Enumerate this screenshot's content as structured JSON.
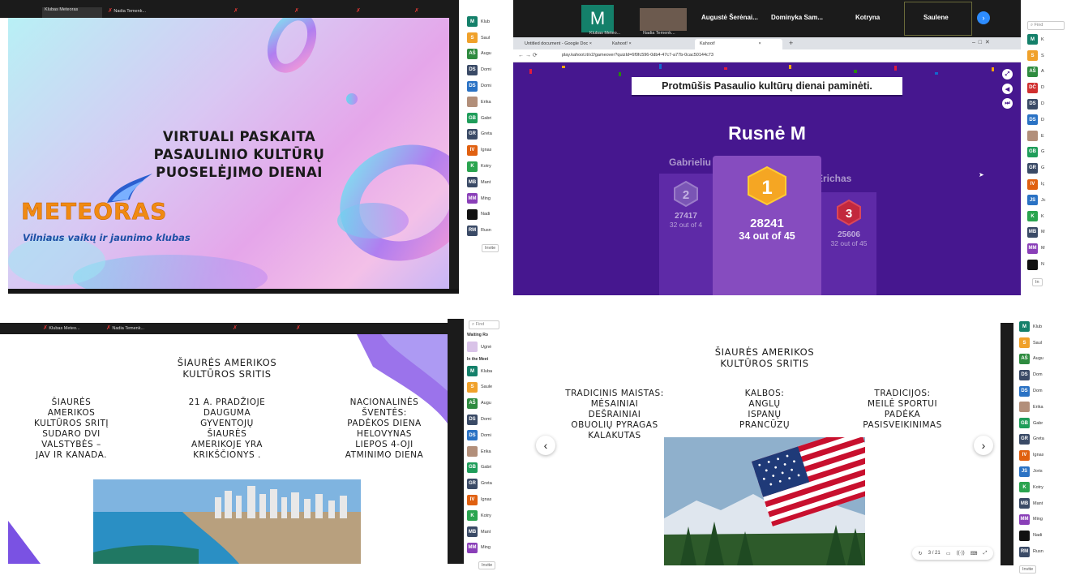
{
  "q1": {
    "strip": [
      {
        "label": "Klubas Meteoras"
      },
      {
        "label": "Nadia Temenk..."
      }
    ],
    "title_lines": [
      "VIRTUALI PASKAITA",
      "PASAULINIO KULTŪRŲ",
      "PUOSELĖJIMO DIENAI"
    ],
    "logo_text": "METEORAS",
    "logo_sub": "Vilniaus vaikų ir jaunimo klubas",
    "participants": [
      {
        "initials": "M",
        "name": "Klub",
        "color": "#14806a"
      },
      {
        "initials": "S",
        "name": "Saul",
        "color": "#f0a12a"
      },
      {
        "initials": "AŠ",
        "name": "Augu",
        "color": "#2e8b3f"
      },
      {
        "initials": "DS",
        "name": "Domi",
        "color": "#3a4a66"
      },
      {
        "initials": "DS",
        "name": "Domi",
        "color": "#2a72c4"
      },
      {
        "initials": "",
        "name": "Erika",
        "color": "#b28f7a"
      },
      {
        "initials": "GB",
        "name": "Gabri",
        "color": "#1f9d5a"
      },
      {
        "initials": "GR",
        "name": "Greta",
        "color": "#3a4a66"
      },
      {
        "initials": "IV",
        "name": "Ignas",
        "color": "#e06010"
      },
      {
        "initials": "K",
        "name": "Kotry",
        "color": "#2aa44f"
      },
      {
        "initials": "MB",
        "name": "Mant",
        "color": "#3a4a66"
      },
      {
        "initials": "MM",
        "name": "Ming",
        "color": "#8a3fb8"
      },
      {
        "initials": "",
        "name": "Nadi",
        "color": "#111111"
      },
      {
        "initials": "RM",
        "name": "Rusn",
        "color": "#3a4a66"
      }
    ],
    "invite": "Invite"
  },
  "q2": {
    "top_tile_letter": "M",
    "top_tile_name": "Klubas Meteo...",
    "top_video_name": "Nadia Temenk...",
    "top_names": [
      "Augustė Šerėnai...",
      "Dominyka Sam...",
      "Kotryna",
      "Saulene"
    ],
    "tabs": [
      "Untitled document - Google Doc",
      "Kahoot!",
      "Kahoot!"
    ],
    "url": "play.kahoot.it/v2/gameover?quizId=6f0fc596-0db4-47c7-a77b-0cac50144c73",
    "quiz_title": "Protmūšis Pasaulio kultūrų dienai paminėti.",
    "winner": "Rusnė M",
    "podium": [
      {
        "rank": "1",
        "name": "",
        "score": "28241",
        "detail": "34 out of 45"
      },
      {
        "rank": "2",
        "name": "Gabrieliu",
        "score": "27417",
        "detail": "32 out of 4"
      },
      {
        "rank": "3",
        "name": "Erichas",
        "score": "25606",
        "detail": "32 out of 45"
      }
    ],
    "participants": [
      {
        "initials": "M",
        "name": "K",
        "color": "#14806a"
      },
      {
        "initials": "S",
        "name": "S",
        "color": "#f0a12a"
      },
      {
        "initials": "AŠ",
        "name": "A",
        "color": "#2e8b3f"
      },
      {
        "initials": "DČ",
        "name": "D",
        "color": "#d03030"
      },
      {
        "initials": "DS",
        "name": "D",
        "color": "#3a4a66"
      },
      {
        "initials": "DS",
        "name": "D",
        "color": "#2a72c4"
      },
      {
        "initials": "",
        "name": "E",
        "color": "#b28f7a"
      },
      {
        "initials": "GB",
        "name": "G",
        "color": "#1f9d5a"
      },
      {
        "initials": "GR",
        "name": "G",
        "color": "#3a4a66"
      },
      {
        "initials": "IV",
        "name": "Iç",
        "color": "#e06010"
      },
      {
        "initials": "JS",
        "name": "Jc",
        "color": "#2a72c4"
      },
      {
        "initials": "K",
        "name": "K",
        "color": "#2aa44f"
      },
      {
        "initials": "MB",
        "name": "M",
        "color": "#3a4a66"
      },
      {
        "initials": "MM",
        "name": "M",
        "color": "#8a3fb8"
      },
      {
        "initials": "",
        "name": "N",
        "color": "#111111"
      }
    ],
    "invite": "In",
    "search_placeholder": "Find"
  },
  "q3": {
    "strip": [
      {
        "label": "Klubas Meteo..."
      },
      {
        "label": "Nadia Temenk..."
      }
    ],
    "heading_lines": [
      "ŠIAURĖS AMERIKOS",
      "KULTŪROS SRITIS"
    ],
    "col1": [
      "ŠIAURĖS",
      "AMERIKOS",
      "KULTŪROS SRITĮ",
      "SUDARO DVI",
      "VALSTYBĖS –",
      "JAV IR KANADA."
    ],
    "col2": [
      "21 A. PRADŽIOJE",
      "DAUGUMA",
      "GYVENTOJŲ",
      "ŠIAURĖS",
      "AMERIKOJE YRA",
      "KRIKŠČIONYS ."
    ],
    "col3": [
      "NACIONALINĖS",
      "ŠVENTĖS:",
      "PADĖKOS DIENA",
      "HELOVYNAS",
      "LIEPOS 4-OJI",
      "ATMINIMO DIENA"
    ],
    "panel": {
      "search_placeholder": "Find",
      "waiting_title": "Waiting Ro",
      "waiting": [
        {
          "initials": "",
          "name": "Ugnė",
          "color": "#d9c3e8"
        }
      ],
      "meeting_title": "In the Meet",
      "participants": [
        {
          "initials": "M",
          "name": "Kluba",
          "color": "#14806a"
        },
        {
          "initials": "S",
          "name": "Saule",
          "color": "#f0a12a"
        },
        {
          "initials": "AŠ",
          "name": "Augu",
          "color": "#2e8b3f"
        },
        {
          "initials": "DS",
          "name": "Domi",
          "color": "#3a4a66"
        },
        {
          "initials": "DS",
          "name": "Domi",
          "color": "#2a72c4"
        },
        {
          "initials": "",
          "name": "Erika",
          "color": "#b28f7a"
        },
        {
          "initials": "GB",
          "name": "Gabri",
          "color": "#1f9d5a"
        },
        {
          "initials": "GR",
          "name": "Greta",
          "color": "#3a4a66"
        },
        {
          "initials": "IV",
          "name": "Ignas",
          "color": "#e06010"
        },
        {
          "initials": "K",
          "name": "Kotry",
          "color": "#2aa44f"
        },
        {
          "initials": "MB",
          "name": "Mant",
          "color": "#3a4a66"
        },
        {
          "initials": "MM",
          "name": "Ming",
          "color": "#8a3fb8"
        }
      ],
      "invite": "Invite"
    }
  },
  "q4": {
    "heading_lines": [
      "ŠIAURĖS AMERIKOS",
      "KULTŪROS SRITIS"
    ],
    "col1": [
      "TRADICINIS MAISTAS:",
      "MĖSAINIAI",
      "DEŠRAINIAI",
      "OBUOLIŲ PYRAGAS",
      "KALAKUTAS"
    ],
    "col2": [
      "KALBOS:",
      "ANGLŲ",
      "ISPANŲ",
      "PRANCŪZŲ"
    ],
    "col3": [
      "TRADICIJOS:",
      "MEILĖ SPORTUI",
      "PADĖKA",
      "PASISVEIKINIMAS"
    ],
    "page": "3 / 21",
    "participants": [
      {
        "initials": "M",
        "name": "Klub",
        "color": "#14806a"
      },
      {
        "initials": "S",
        "name": "Saul",
        "color": "#f0a12a"
      },
      {
        "initials": "AŠ",
        "name": "Augu",
        "color": "#2e8b3f"
      },
      {
        "initials": "DS",
        "name": "Dom",
        "color": "#3a4a66"
      },
      {
        "initials": "DS",
        "name": "Dom",
        "color": "#2a72c4"
      },
      {
        "initials": "",
        "name": "Erika",
        "color": "#b28f7a"
      },
      {
        "initials": "GB",
        "name": "Gabr",
        "color": "#1f9d5a"
      },
      {
        "initials": "GR",
        "name": "Greta",
        "color": "#3a4a66"
      },
      {
        "initials": "IV",
        "name": "Ignas",
        "color": "#e06010"
      },
      {
        "initials": "JS",
        "name": "Joris",
        "color": "#2a72c4"
      },
      {
        "initials": "K",
        "name": "Kotry",
        "color": "#2aa44f"
      },
      {
        "initials": "MB",
        "name": "Mant",
        "color": "#3a4a66"
      },
      {
        "initials": "MM",
        "name": "Ming",
        "color": "#8a3fb8"
      },
      {
        "initials": "",
        "name": "Nadi",
        "color": "#111111"
      },
      {
        "initials": "RM",
        "name": "Rusn",
        "color": "#3a4a66"
      }
    ],
    "invite": "Invite"
  }
}
